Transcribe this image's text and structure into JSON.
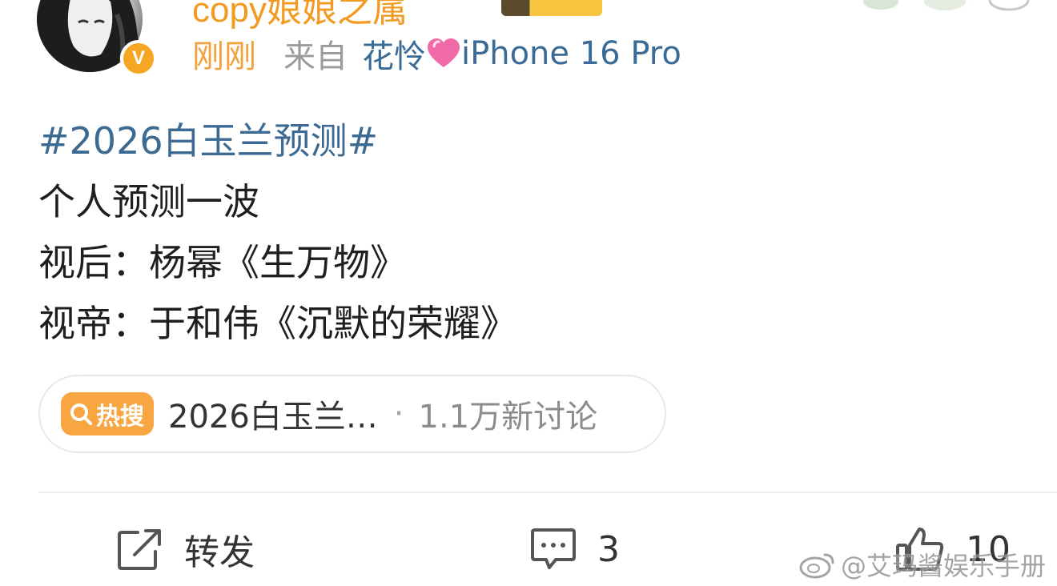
{
  "post": {
    "author": {
      "username": "copy娘娘之属",
      "verified": true
    },
    "meta": {
      "time": "刚刚",
      "from_label": "来自",
      "device_prefix": "花怜",
      "device_suffix": "iPhone 16 Pro"
    },
    "content": {
      "hashtag": "#2026白玉兰预测#",
      "lines": [
        "个人预测一波",
        "视后：杨幂《生万物》",
        "视帝：于和伟《沉默的荣耀》"
      ]
    },
    "hot_search": {
      "tag_label": "热搜",
      "topic": "2026白玉兰…",
      "separator": "·",
      "count": "1.1万新讨论"
    }
  },
  "actions": {
    "repost_label": "转发",
    "comment_count": "3",
    "like_count": "10"
  },
  "watermark": "@艾玛酱娱乐手册",
  "colors": {
    "accent_orange": "#f29a22",
    "link_blue": "#3c6a92",
    "hot_tag": "#f7a642"
  }
}
